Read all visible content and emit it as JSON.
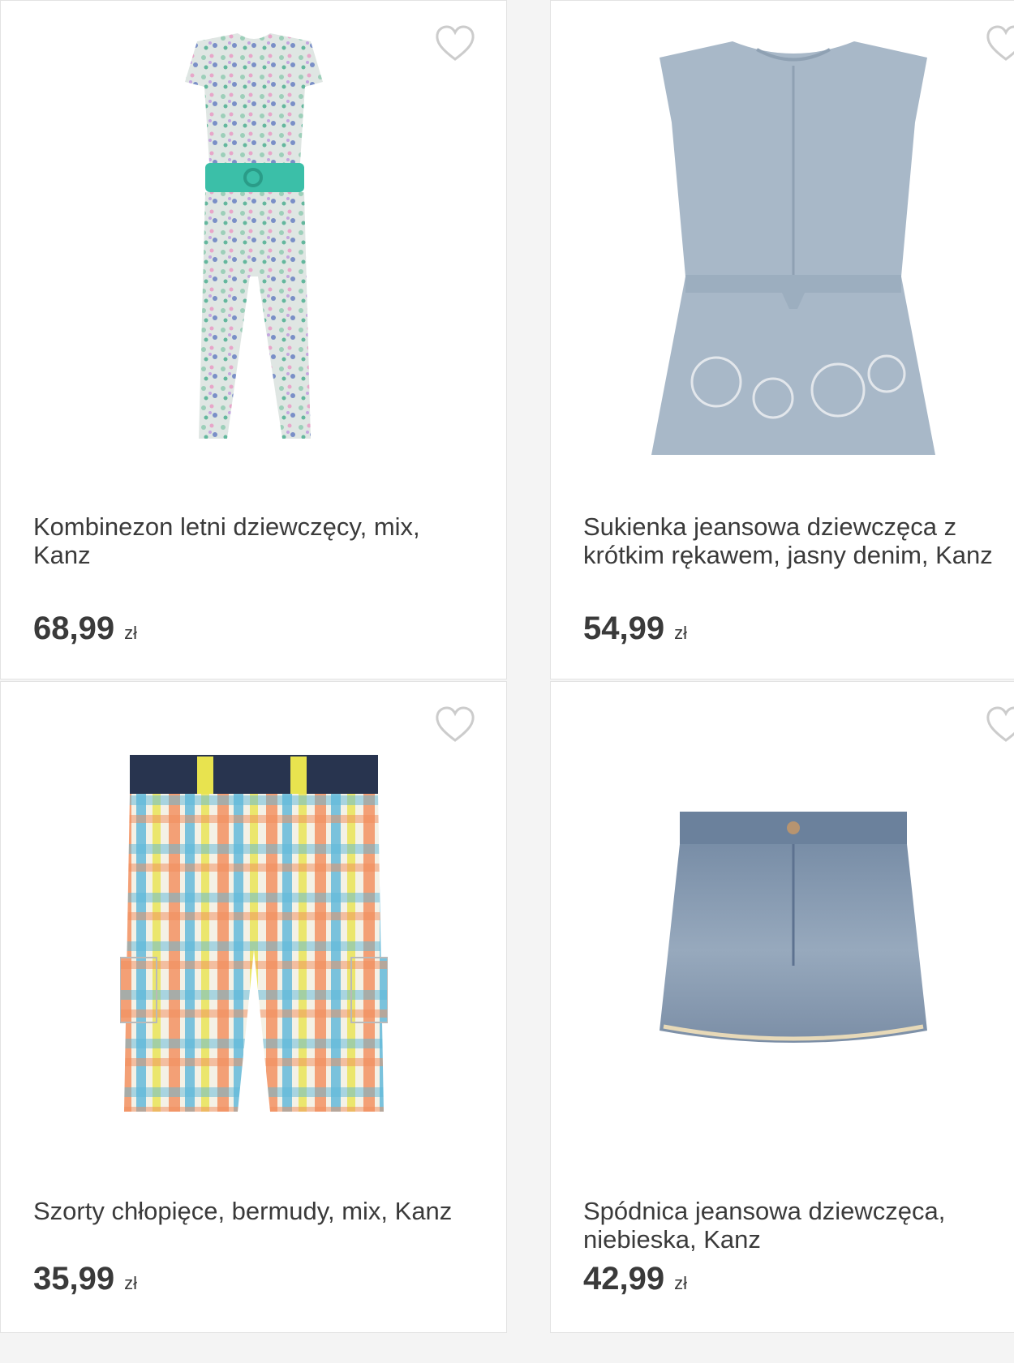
{
  "products": [
    {
      "title": "Kombinezon letni dziewczęcy, mix, Kanz",
      "price": "68,99",
      "currency": "zł",
      "image": "floral-jumpsuit"
    },
    {
      "title": "Sukienka jeansowa dziewczęca z krótkim rękawem, jasny denim, Kanz",
      "price": "54,99",
      "currency": "zł",
      "image": "denim-dress"
    },
    {
      "title": "Szorty chłopięce, bermudy, mix, Kanz",
      "price": "35,99",
      "currency": "zł",
      "image": "plaid-shorts"
    },
    {
      "title": "Spódnica jeansowa dziewczęca, niebieska, Kanz",
      "price": "42,99",
      "currency": "zł",
      "image": "denim-skirt"
    }
  ],
  "icons": {
    "favorite": "heart-outline-icon"
  },
  "colors": {
    "text": "#3a3a3a",
    "heart": "#cccccc",
    "card_border": "#e3e3e3"
  }
}
